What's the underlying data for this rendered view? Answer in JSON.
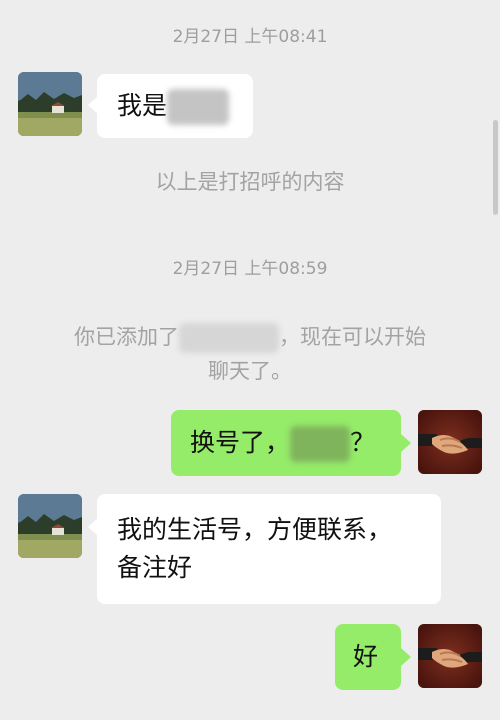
{
  "messages": {
    "time1": "2月27日 上午08:41",
    "incoming1_text": "我是",
    "greeting_note": "以上是打招呼的内容",
    "time2": "2月27日 上午08:59",
    "added_line1_prefix": "你已添加了",
    "added_line1_suffix": "，现在可以开始",
    "added_line2": "聊天了。",
    "outgoing1_prefix": "换号了，",
    "outgoing1_suffix": "？",
    "incoming2_line1": "我的生活号，方便联系，",
    "incoming2_line2": "备注好",
    "outgoing2_text": "好"
  },
  "colors": {
    "background": "#ededed",
    "incoming_bubble": "#ffffff",
    "outgoing_bubble": "#95ec69",
    "timestamp_text": "#9e9e9e"
  },
  "icons": {
    "contact_avatar": "landscape-avatar-icon",
    "self_avatar": "handshake-avatar-icon"
  }
}
